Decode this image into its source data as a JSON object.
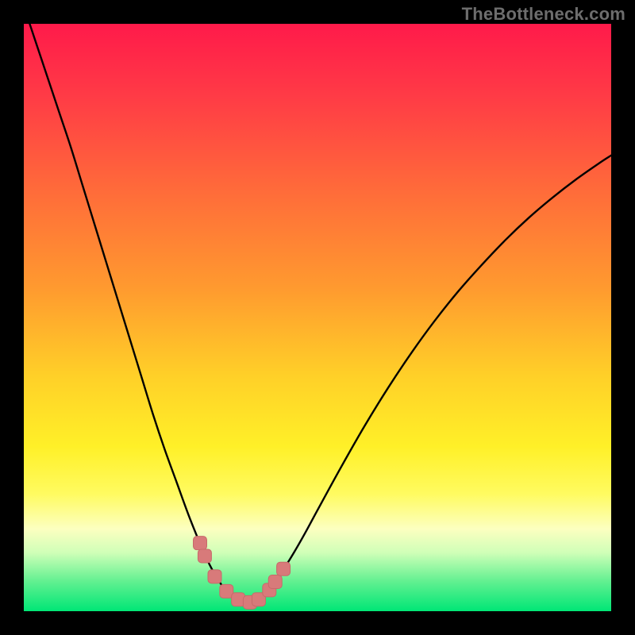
{
  "watermark": "TheBottleneck.com",
  "colors": {
    "frame": "#000000",
    "curve_stroke": "#000000",
    "marker_fill": "#d87a7a",
    "marker_stroke": "#c76a6a",
    "gradient_stops": [
      {
        "offset": 0.0,
        "color": "#ff1a4a"
      },
      {
        "offset": 0.12,
        "color": "#ff3a46"
      },
      {
        "offset": 0.28,
        "color": "#ff6a3a"
      },
      {
        "offset": 0.45,
        "color": "#ff9a2f"
      },
      {
        "offset": 0.6,
        "color": "#ffd028"
      },
      {
        "offset": 0.72,
        "color": "#fff028"
      },
      {
        "offset": 0.8,
        "color": "#fffb60"
      },
      {
        "offset": 0.86,
        "color": "#fcffc0"
      },
      {
        "offset": 0.9,
        "color": "#d0ffb8"
      },
      {
        "offset": 0.95,
        "color": "#60f090"
      },
      {
        "offset": 1.0,
        "color": "#00e676"
      }
    ]
  },
  "chart_data": {
    "type": "line",
    "title": "",
    "xlabel": "",
    "ylabel": "",
    "xlim": [
      0,
      100
    ],
    "ylim": [
      0,
      100
    ],
    "grid": false,
    "legend": false,
    "x": [
      0,
      2,
      4,
      6,
      8,
      10,
      12,
      14,
      16,
      18,
      20,
      22,
      24,
      26,
      28,
      30,
      31,
      32,
      33,
      34,
      35,
      36,
      37,
      38,
      39,
      40,
      42,
      44,
      46,
      48,
      50,
      54,
      58,
      62,
      66,
      70,
      74,
      78,
      82,
      86,
      90,
      94,
      98,
      100
    ],
    "values": [
      103,
      97,
      91,
      85,
      79,
      72.5,
      66,
      59.5,
      53,
      46.5,
      40,
      33.5,
      27.5,
      22,
      16.5,
      11.5,
      9.2,
      7.2,
      5.5,
      4.0,
      2.9,
      2.1,
      1.6,
      1.4,
      1.6,
      2.1,
      4.0,
      6.8,
      10.0,
      13.5,
      17.2,
      24.5,
      31.5,
      38.0,
      44.0,
      49.5,
      54.5,
      59.0,
      63.2,
      67.0,
      70.4,
      73.5,
      76.3,
      77.6
    ],
    "markers": {
      "x": [
        30.0,
        30.8,
        32.5,
        34.5,
        36.5,
        38.5,
        40.0,
        41.8,
        42.8,
        44.2
      ],
      "values": [
        11.6,
        9.4,
        5.9,
        3.4,
        2.0,
        1.5,
        2.0,
        3.6,
        5.0,
        7.2
      ]
    }
  }
}
